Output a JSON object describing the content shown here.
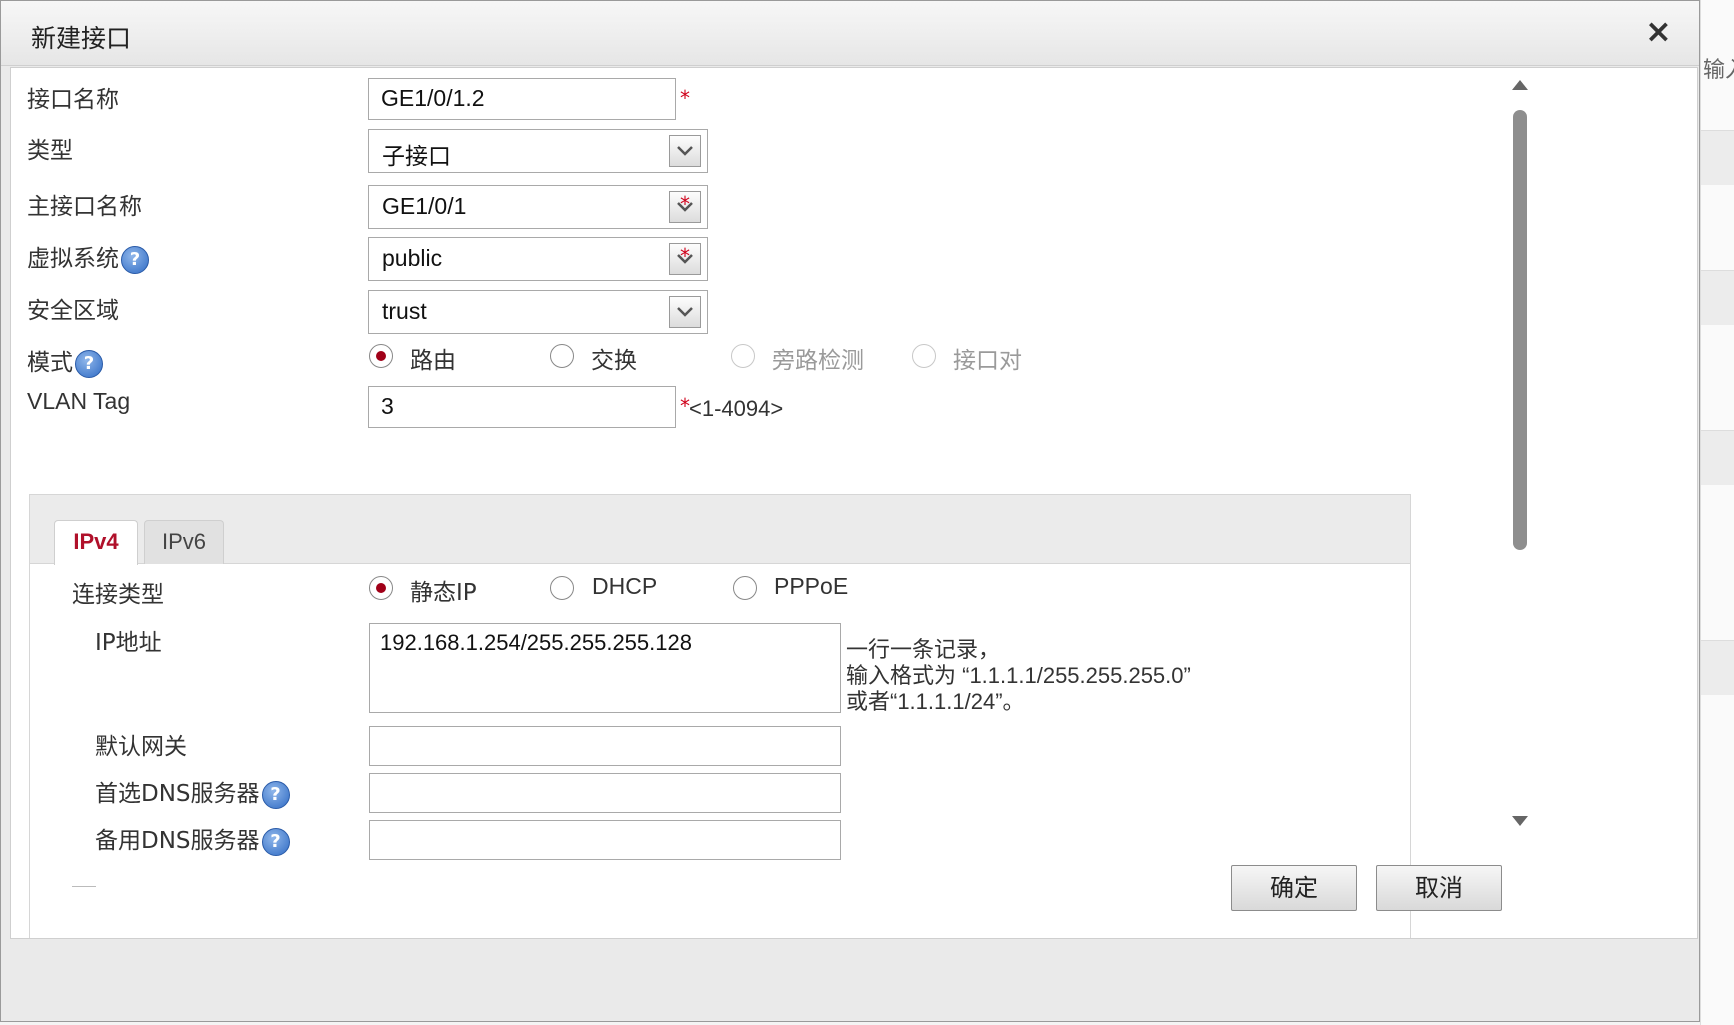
{
  "dialog": {
    "title": "新建接口",
    "close_glyph": "×"
  },
  "form": {
    "interface_name": {
      "label": "接口名称",
      "value": "GE1/0/1.2",
      "required": "*"
    },
    "type": {
      "label": "类型",
      "value": "子接口"
    },
    "main_interface": {
      "label": "主接口名称",
      "value": "GE1/0/1",
      "required": "*"
    },
    "virtual_system": {
      "label": "虚拟系统",
      "value": "public",
      "required": "*",
      "help": "?"
    },
    "security_zone": {
      "label": "安全区域",
      "value": "trust"
    },
    "mode": {
      "label": "模式",
      "help": "?",
      "options": [
        "路由",
        "交换",
        "旁路检测",
        "接口对"
      ],
      "selected": "路由",
      "disabled": [
        "旁路检测",
        "接口对"
      ]
    },
    "vlan_tag": {
      "label": "VLAN Tag",
      "value": "3",
      "required": "*",
      "range": "<1-4094>"
    }
  },
  "tabs": {
    "items": [
      "IPv4",
      "IPv6"
    ],
    "active": "IPv4"
  },
  "ipv4": {
    "connection_type": {
      "label": "连接类型",
      "options": [
        "静态IP",
        "DHCP",
        "PPPoE"
      ],
      "selected": "静态IP"
    },
    "ip_address": {
      "label": "IP地址",
      "value": "192.168.1.254/255.255.255.128",
      "hint_line1": "一行一条记录，",
      "hint_line2": "输入格式为 “1.1.1.1/255.255.255.0”",
      "hint_line3": "或者“1.1.1.1/24”。"
    },
    "default_gateway": {
      "label": "默认网关",
      "value": ""
    },
    "primary_dns": {
      "label": "首选DNS服务器",
      "value": "",
      "help": "?"
    },
    "secondary_dns": {
      "label": "备用DNS服务器",
      "value": "",
      "help": "?"
    }
  },
  "footer": {
    "ok_label": "确定",
    "cancel_label": "取消"
  },
  "background": {
    "partial_text": "输入"
  },
  "colors": {
    "accent": "#b0102a",
    "required": "#d0021b",
    "help_icon": "#2f6bc4"
  }
}
